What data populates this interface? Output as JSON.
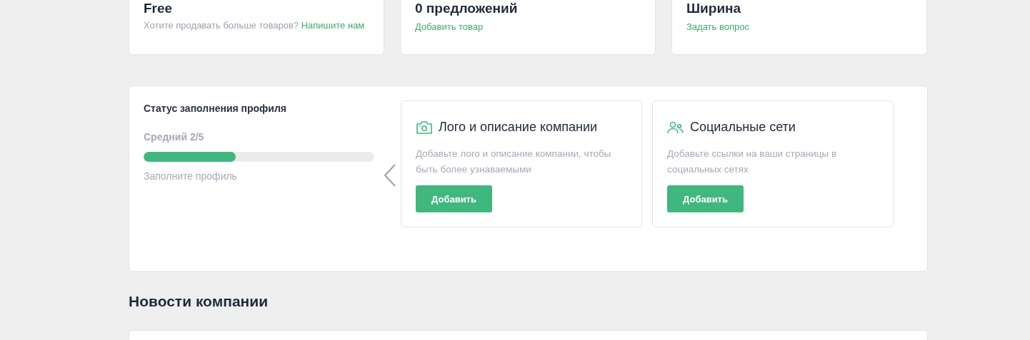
{
  "summary_cards": [
    {
      "title": "Free",
      "text": "Хотите продавать больше товаров?",
      "link": "Напишите нам"
    },
    {
      "title": "0 предложений",
      "link": "Добавить товар"
    },
    {
      "title": "Ширина",
      "link": "Задать вопрос"
    }
  ],
  "profile_status": {
    "title": "Статус заполнения профиля",
    "level_label": "Средний 2/5",
    "level": 0.4,
    "hint": "Заполните профиль",
    "tasks": [
      {
        "kind": "camera",
        "title": "Лого и описание компании",
        "text": "Добавьте лого и описание компании, чтобы быть более узнаваемыми",
        "button": "Добавить"
      },
      {
        "kind": "people",
        "title": "Социальные сети",
        "text": "Добавьте ссылки на ваши страницы в социальных сетях",
        "button": "Добавить"
      }
    ]
  },
  "news": {
    "title": "Новости компании"
  }
}
